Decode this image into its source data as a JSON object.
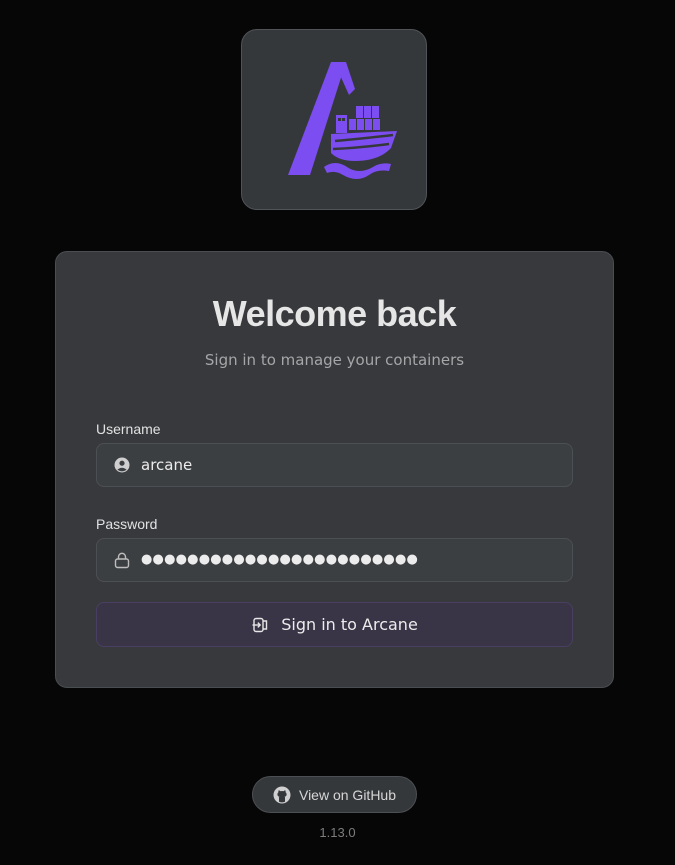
{
  "brand": {
    "logo_icon": "arcane-ship-logo-icon",
    "accent_color": "#7c4df0"
  },
  "login": {
    "title": "Welcome back",
    "subtitle": "Sign in to manage your containers",
    "username_label": "Username",
    "username_value": "arcane",
    "username_icon": "user-circle-icon",
    "password_label": "Password",
    "password_masked": "●●●●●●●●●●●●●●●●●●●●●●●●",
    "password_icon": "lock-icon",
    "submit_label": "Sign in to Arcane",
    "submit_icon": "sign-in-icon"
  },
  "footer": {
    "github_label": "View on GitHub",
    "github_icon": "github-icon",
    "version": "1.13.0"
  }
}
